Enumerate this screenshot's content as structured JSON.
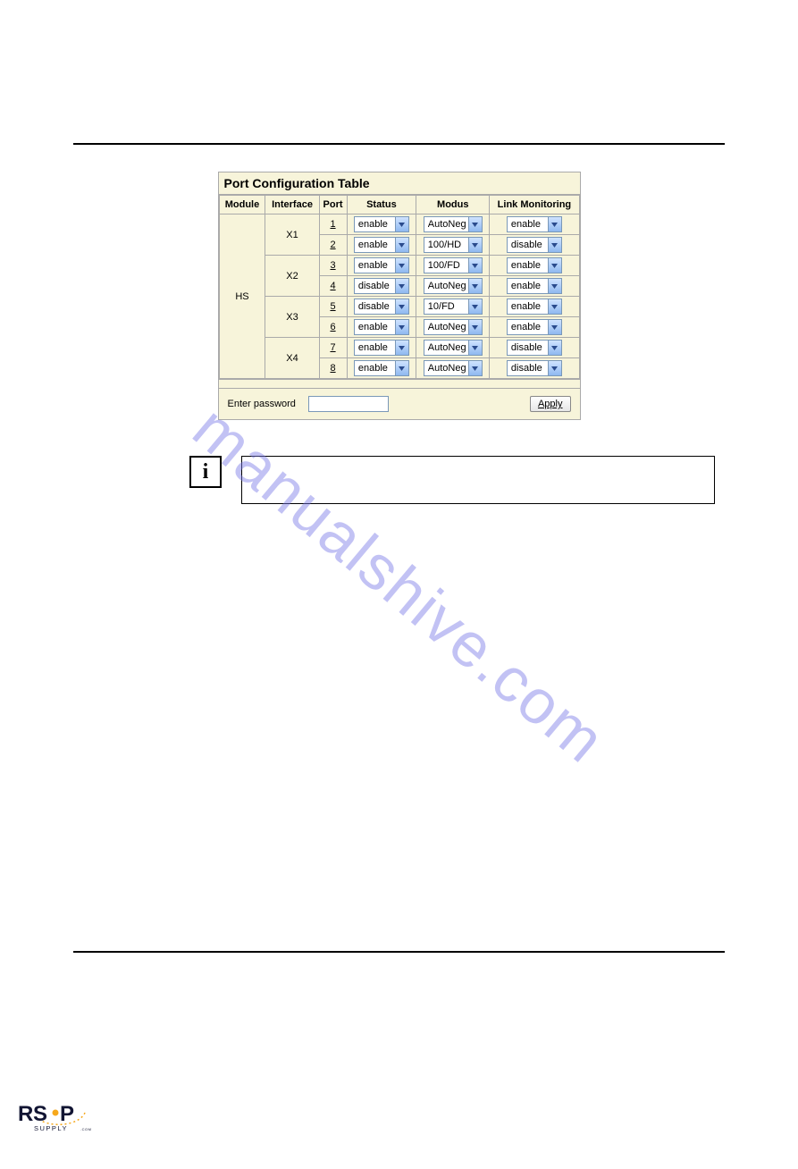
{
  "table": {
    "title": "Port Configuration Table",
    "headers": {
      "module": "Module",
      "interface": "Interface",
      "port": "Port",
      "status": "Status",
      "modus": "Modus",
      "link": "Link Monitoring"
    },
    "module": "HS",
    "interfaces": [
      {
        "name": "X1",
        "rows": [
          {
            "port": "1",
            "status": "enable",
            "modus": "AutoNeg",
            "link": "enable"
          },
          {
            "port": "2",
            "status": "enable",
            "modus": "100/HD",
            "link": "disable"
          }
        ]
      },
      {
        "name": "X2",
        "rows": [
          {
            "port": "3",
            "status": "enable",
            "modus": "100/FD",
            "link": "enable"
          },
          {
            "port": "4",
            "status": "disable",
            "modus": "AutoNeg",
            "link": "enable"
          }
        ]
      },
      {
        "name": "X3",
        "rows": [
          {
            "port": "5",
            "status": "disable",
            "modus": "10/FD",
            "link": "enable"
          },
          {
            "port": "6",
            "status": "enable",
            "modus": "AutoNeg",
            "link": "enable"
          }
        ]
      },
      {
        "name": "X4",
        "rows": [
          {
            "port": "7",
            "status": "enable",
            "modus": "AutoNeg",
            "link": "disable"
          },
          {
            "port": "8",
            "status": "enable",
            "modus": "AutoNeg",
            "link": "disable"
          }
        ]
      }
    ],
    "password_label": "Enter password",
    "apply_label": "Apply"
  },
  "info_symbol": "i",
  "watermark": "manualshive.com",
  "logo": {
    "top": "RSP",
    "bottom": "SUPPLY.COM"
  }
}
